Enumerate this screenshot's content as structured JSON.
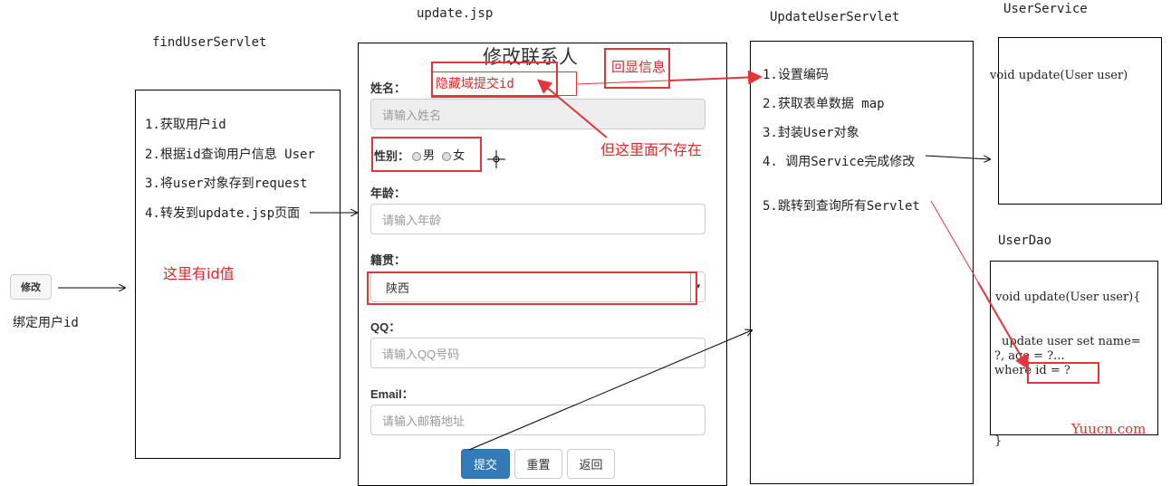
{
  "headings": {
    "find_user_servlet": "findUserServlet",
    "update_jsp": "update.jsp",
    "update_user_servlet": "UpdateUserServlet",
    "user_service": "UserService",
    "user_dao": "UserDao"
  },
  "left": {
    "edit_button": "修改",
    "bind_label": "绑定用户id"
  },
  "find_steps": [
    "1.获取用户id",
    "2.根据id查询用户信息 User",
    "3.将user对象存到request",
    "4.转发到update.jsp页面"
  ],
  "find_note": "这里有id值",
  "form": {
    "title": "修改联系人",
    "hidden_note": "隐藏域提交id",
    "name_label": "姓名：",
    "name_placeholder": "请输入姓名",
    "gender_label": "性别：",
    "gender_male": "男",
    "gender_female": "女",
    "age_label": "年龄：",
    "age_placeholder": "请输入年龄",
    "origin_label": "籍贯：",
    "origin_value": "陕西",
    "qq_label": "QQ：",
    "qq_placeholder": "请输入QQ号码",
    "email_label": "Email：",
    "email_placeholder": "请输入邮箱地址",
    "submit": "提交",
    "reset": "重置",
    "back": "返回"
  },
  "echo_note": "回显信息",
  "not_exist_note": "但这里面不存在",
  "servlet_steps": [
    "1.设置编码",
    "2.获取表单数据 map",
    "3.封装User对象",
    "4. 调用Service完成修改",
    "5.跳转到查询所有Servlet"
  ],
  "service_method": "void update(User user)",
  "dao": {
    "signature": "void update(User user){",
    "sql_line1": "update user set name=",
    "sql_line2": "?, age = ?...",
    "sql_line3": "where id = ?",
    "closing": "}"
  },
  "watermark": "Yuucn.com",
  "colors": {
    "annotation_red": "#e0282b",
    "primary_button": "#337ab7"
  }
}
